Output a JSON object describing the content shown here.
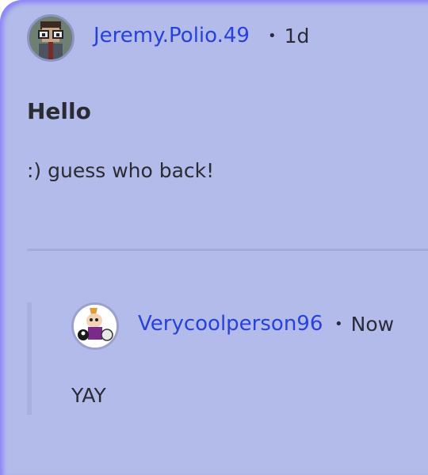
{
  "post": {
    "author": "Jeremy.Polio.49",
    "separator": "•",
    "time": "1d",
    "title": "Hello",
    "body": ":) guess who back!"
  },
  "reply": {
    "author": "Verycoolperson96",
    "separator": "•",
    "time": "Now",
    "body": "YAY"
  },
  "colors": {
    "card_background": "#b3bbeb",
    "author_link": "#2742d8",
    "text": "#2b2b33",
    "divider": "#a5acd9"
  }
}
